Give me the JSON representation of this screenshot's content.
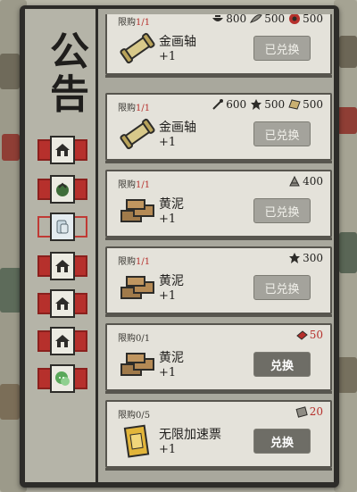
{
  "panel": {
    "title": "公告"
  },
  "tabs": [
    {
      "icon": "house-icon",
      "selected": false
    },
    {
      "icon": "dumpling-icon",
      "selected": false
    },
    {
      "icon": "scroll-icon",
      "selected": true
    },
    {
      "icon": "house-icon",
      "selected": false
    },
    {
      "icon": "house-icon",
      "selected": false
    },
    {
      "icon": "house-icon",
      "selected": false
    },
    {
      "icon": "chat-icon",
      "selected": false
    }
  ],
  "items": [
    {
      "limit_label": "限购",
      "limit_value": "1/1",
      "icon": "golden-scroll-icon",
      "name": "金画轴",
      "qty": "+1",
      "button": "已兑换",
      "redeemed": true,
      "costs": [
        {
          "icon": "bowl-icon",
          "amount": "800"
        },
        {
          "icon": "feather-icon",
          "amount": "500"
        },
        {
          "icon": "red-seal-icon",
          "amount": "500",
          "red": false
        }
      ]
    },
    {
      "limit_label": "限购",
      "limit_value": "1/1",
      "icon": "golden-scroll-icon",
      "name": "金画轴",
      "qty": "+1",
      "button": "已兑换",
      "redeemed": true,
      "costs": [
        {
          "icon": "brush-icon",
          "amount": "600"
        },
        {
          "icon": "leaf-icon",
          "amount": "500"
        },
        {
          "icon": "paper-icon",
          "amount": "500"
        }
      ]
    },
    {
      "limit_label": "限购",
      "limit_value": "1/1",
      "icon": "clay-bricks-icon",
      "name": "黄泥",
      "qty": "+1",
      "button": "已兑换",
      "redeemed": true,
      "costs": [
        {
          "icon": "fan-icon",
          "amount": "400"
        }
      ]
    },
    {
      "limit_label": "限购",
      "limit_value": "1/1",
      "icon": "clay-bricks-icon",
      "name": "黄泥",
      "qty": "+1",
      "button": "已兑换",
      "redeemed": true,
      "costs": [
        {
          "icon": "leaf-icon",
          "amount": "300"
        }
      ]
    },
    {
      "limit_label": "限购",
      "limit_value": "0/1",
      "icon": "clay-bricks-icon",
      "name": "黄泥",
      "qty": "+1",
      "button": "兑换",
      "redeemed": false,
      "costs": [
        {
          "icon": "red-book-icon",
          "amount": "50",
          "red": true
        }
      ]
    },
    {
      "limit_label": "限购",
      "limit_value": "0/5",
      "icon": "speed-ticket-icon",
      "name": "无限加速票",
      "qty": "+1",
      "button": "兑换",
      "redeemed": false,
      "costs": [
        {
          "icon": "ticket-stub-icon",
          "amount": "20",
          "red": true
        }
      ]
    }
  ],
  "colors": {
    "accent_red": "#b6302c",
    "board_dark": "#2d2c29",
    "card_bg": "#e4e2da"
  }
}
